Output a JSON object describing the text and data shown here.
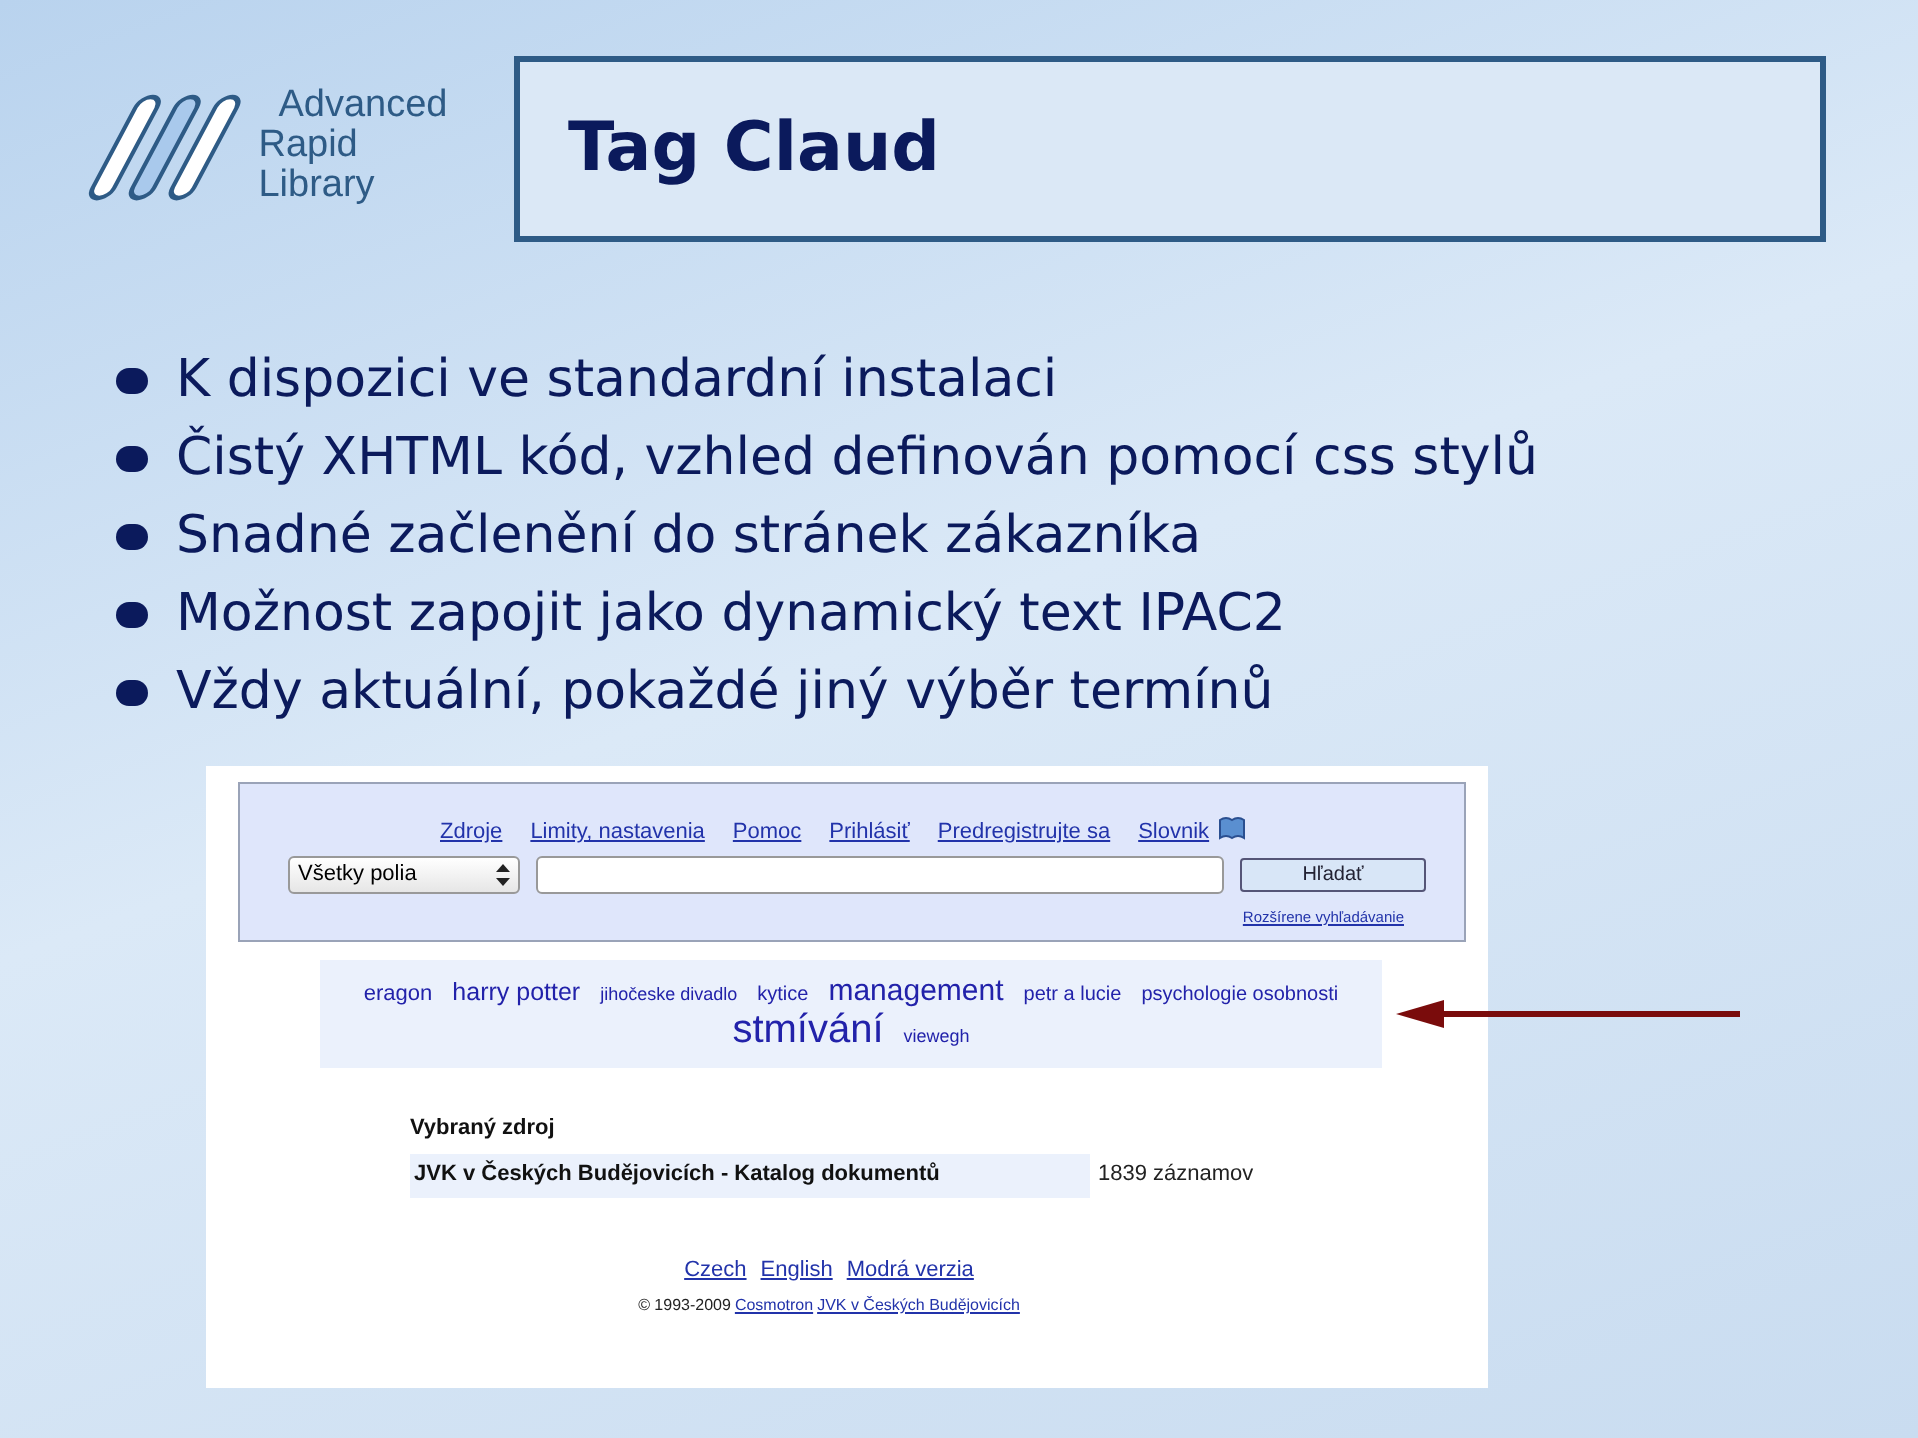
{
  "logo": {
    "lines": [
      "Advanced",
      "Rapid",
      "Library"
    ]
  },
  "title": "Tag Claud",
  "bullets": [
    "K dispozici ve standardní instalaci",
    "Čistý XHTML kód, vzhled definován pomocí css stylů",
    "Snadné začlenění do stránek zákazníka",
    "Možnost zapojit jako dynamický text IPAC2",
    "Vždy aktuální, pokaždé jiný výběr termínů"
  ],
  "screenshot": {
    "nav_links": [
      "Zdroje",
      "Limity, nastavenia",
      "Pomoc",
      "Prihlásiť",
      "Predregistrujte sa",
      "Slovnik"
    ],
    "field_select": "Všetky polia",
    "search_button": "Hľadať",
    "advanced_link": "Rozšírene vyhľadávanie",
    "tags": [
      {
        "text": "eragon",
        "kind": "medium"
      },
      {
        "text": "harry potter",
        "kind": "large"
      },
      {
        "text": "jihočeske divadlo",
        "kind": "tiny"
      },
      {
        "text": "kytice",
        "kind": "small"
      },
      {
        "text": "management",
        "kind": "xlarge"
      },
      {
        "text": "petr a lucie",
        "kind": "small"
      },
      {
        "text": "psychologie osobnosti",
        "kind": "small"
      },
      {
        "text": "stmívání",
        "kind": "huge"
      },
      {
        "text": "viewegh",
        "kind": "tiny"
      }
    ],
    "source_heading": "Vybraný zdroj",
    "source_name": "JVK v Českých Budějovicích - Katalog dokumentů",
    "source_count": "1839 záznamov",
    "language_links": [
      "Czech",
      "English",
      "Modrá verzia"
    ],
    "copyright": "© 1993-2009",
    "footer_links": [
      "Cosmotron",
      "JVK v Českých Budějovicích"
    ]
  }
}
